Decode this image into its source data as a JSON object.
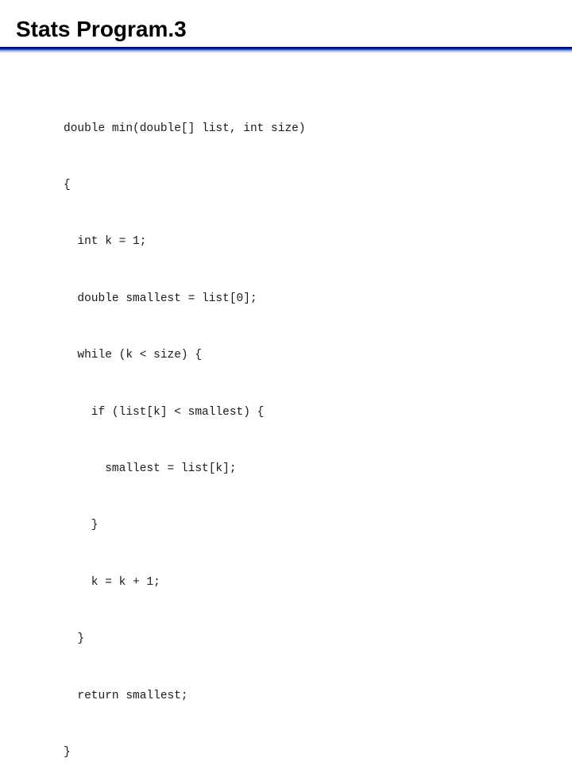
{
  "title": "Stats Program.3",
  "code": {
    "language": "java",
    "lines": [
      "double min(double[] list, int size)",
      "{",
      "  int k = 1;",
      "  double smallest = list[0];",
      "  while (k < size) {",
      "    if (list[k] < smallest) {",
      "      smallest = list[k];",
      "    }",
      "    k = k + 1;",
      "  }",
      "  return smallest;",
      "}"
    ]
  },
  "colors": {
    "title_rule_dark": "#000066",
    "title_rule_light": "#b3c6f2"
  }
}
